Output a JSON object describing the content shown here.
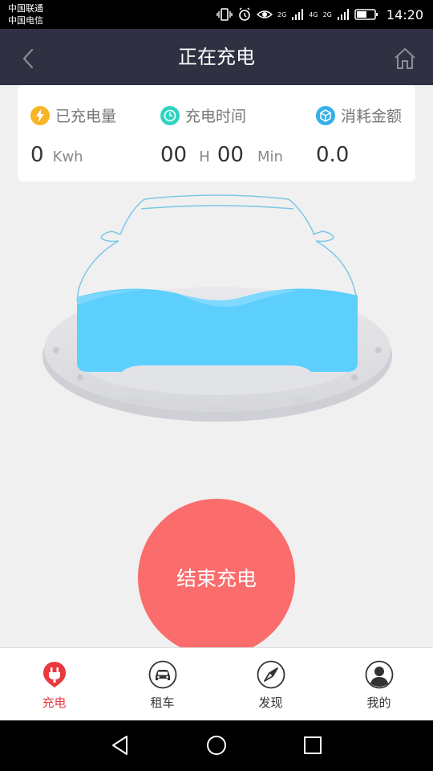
{
  "status_bar": {
    "carrier1": "中国联通",
    "carrier2": "中国电信",
    "net1": "2G",
    "net2": "4G",
    "net3": "2G",
    "time": "14:20"
  },
  "header": {
    "title": "正在充电"
  },
  "stats": {
    "energy": {
      "label": "已充电量",
      "value": "0",
      "unit": "Kwh",
      "icon": "lightning-icon"
    },
    "time": {
      "label": "充电时间",
      "hours": "00",
      "hours_unit": "H",
      "minutes": "00",
      "minutes_unit": "Min",
      "icon": "clock-icon"
    },
    "cost": {
      "label": "消耗金额",
      "value": "0.0",
      "icon": "cube-icon"
    }
  },
  "colors": {
    "header_bg": "#2f3142",
    "accent_red": "#e8393f",
    "button_red": "#fb6c6c",
    "water_blue": "#5ccffd",
    "energy_yellow": "#f8b526",
    "time_teal": "#2ed4c1",
    "cost_blue": "#34b1e8"
  },
  "end_button": {
    "label": "结束充电"
  },
  "tabs": [
    {
      "label": "充电",
      "icon": "plug-icon",
      "active": true
    },
    {
      "label": "租车",
      "icon": "car-icon",
      "active": false
    },
    {
      "label": "发现",
      "icon": "compass-icon",
      "active": false
    },
    {
      "label": "我的",
      "icon": "user-icon",
      "active": false
    }
  ]
}
